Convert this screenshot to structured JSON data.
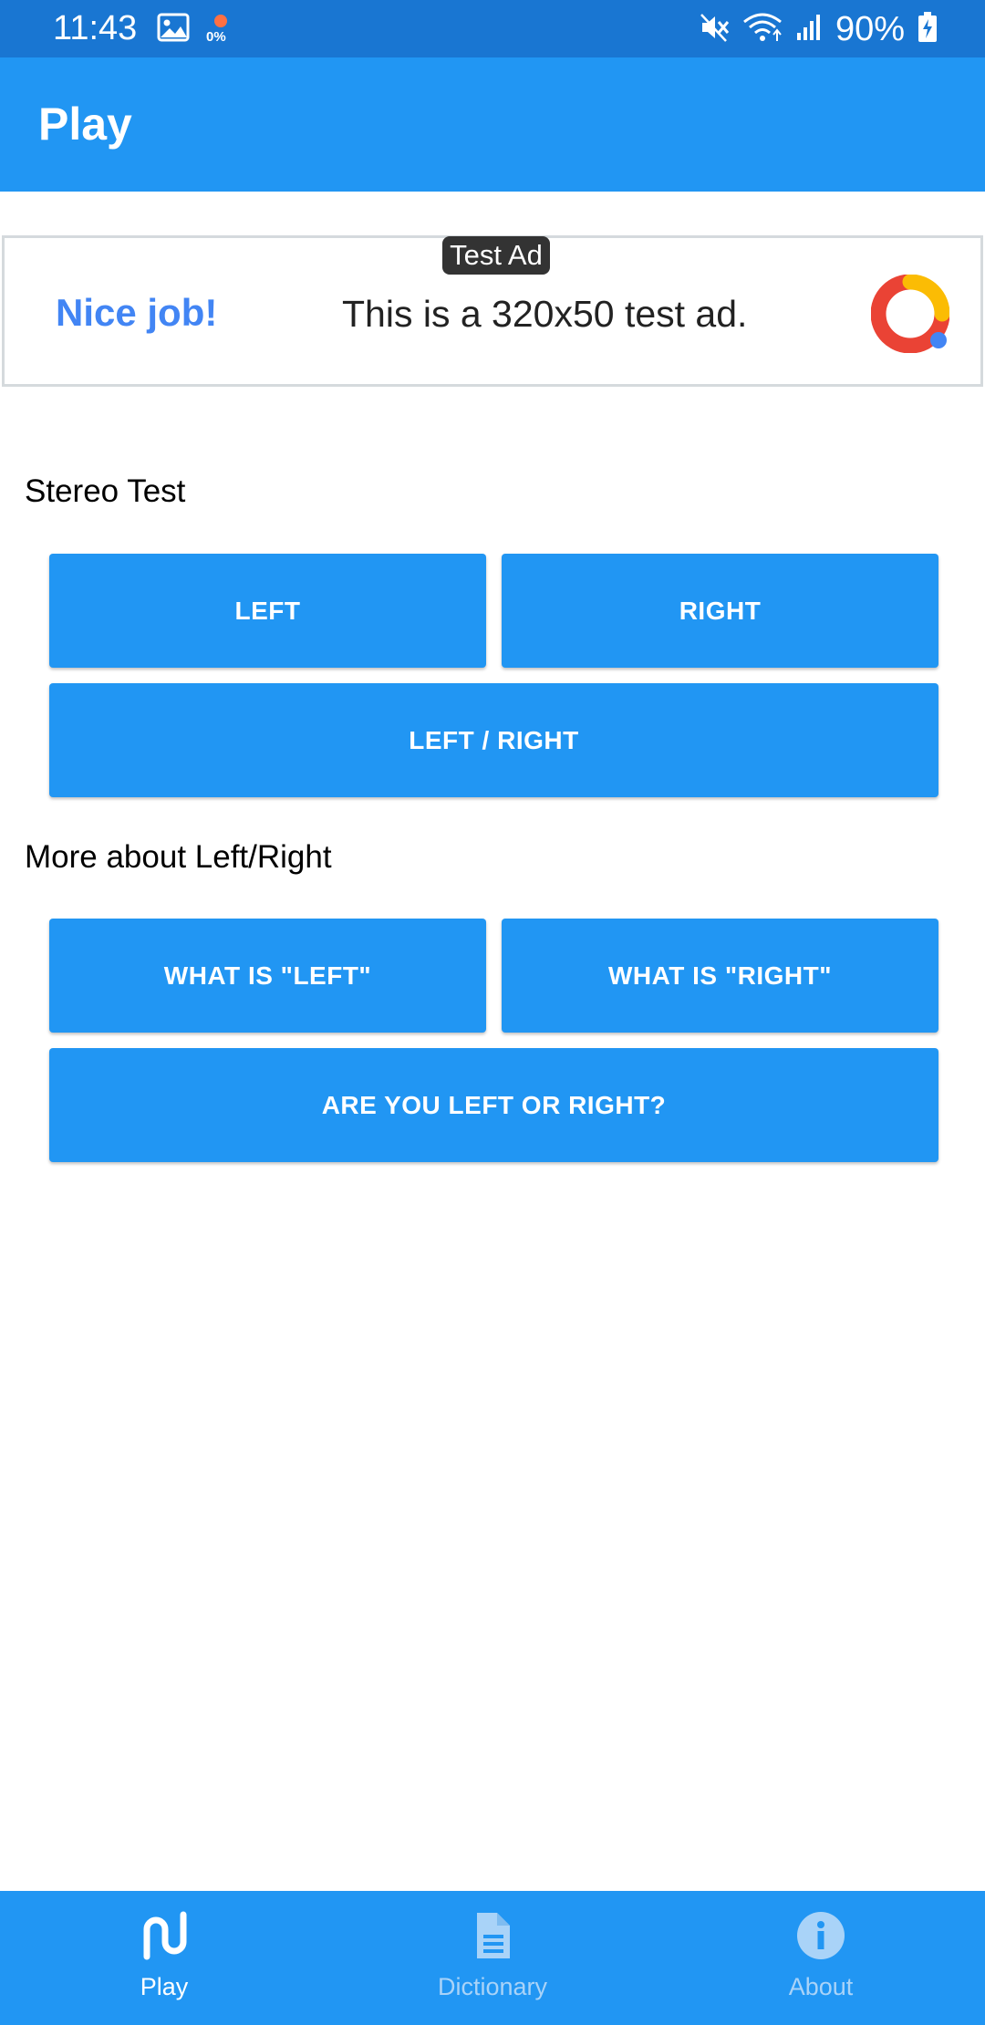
{
  "status_bar": {
    "time": "11:43",
    "data_percent": "0%",
    "battery": "90%",
    "icons": [
      "gallery-icon",
      "data-saver-icon",
      "mute-icon",
      "wifi-icon",
      "signal-icon",
      "battery-charging-icon"
    ]
  },
  "app_bar": {
    "title": "Play"
  },
  "ad": {
    "badge": "Test Ad",
    "headline": "Nice job!",
    "body": "This is a 320x50 test ad.",
    "logo_icon": "admob-logo-icon"
  },
  "stereo_section": {
    "title": "Stereo Test",
    "left_label": "LEFT",
    "right_label": "RIGHT",
    "both_label": "LEFT / RIGHT"
  },
  "more_section": {
    "title": "More about Left/Right",
    "what_left_label": "WHAT IS \"LEFT\"",
    "what_right_label": "WHAT IS \"RIGHT\"",
    "quiz_label": "ARE YOU LEFT OR RIGHT?"
  },
  "bottom_nav": {
    "items": [
      {
        "label": "Play",
        "icon": "play-route-icon",
        "active": true
      },
      {
        "label": "Dictionary",
        "icon": "document-icon",
        "active": false
      },
      {
        "label": "About",
        "icon": "info-icon",
        "active": false
      }
    ]
  },
  "colors": {
    "primary": "#2196F3",
    "status_bar": "#1976D2",
    "nav_inactive": "#A9D3F8",
    "ad_headline": "#4285F4"
  }
}
